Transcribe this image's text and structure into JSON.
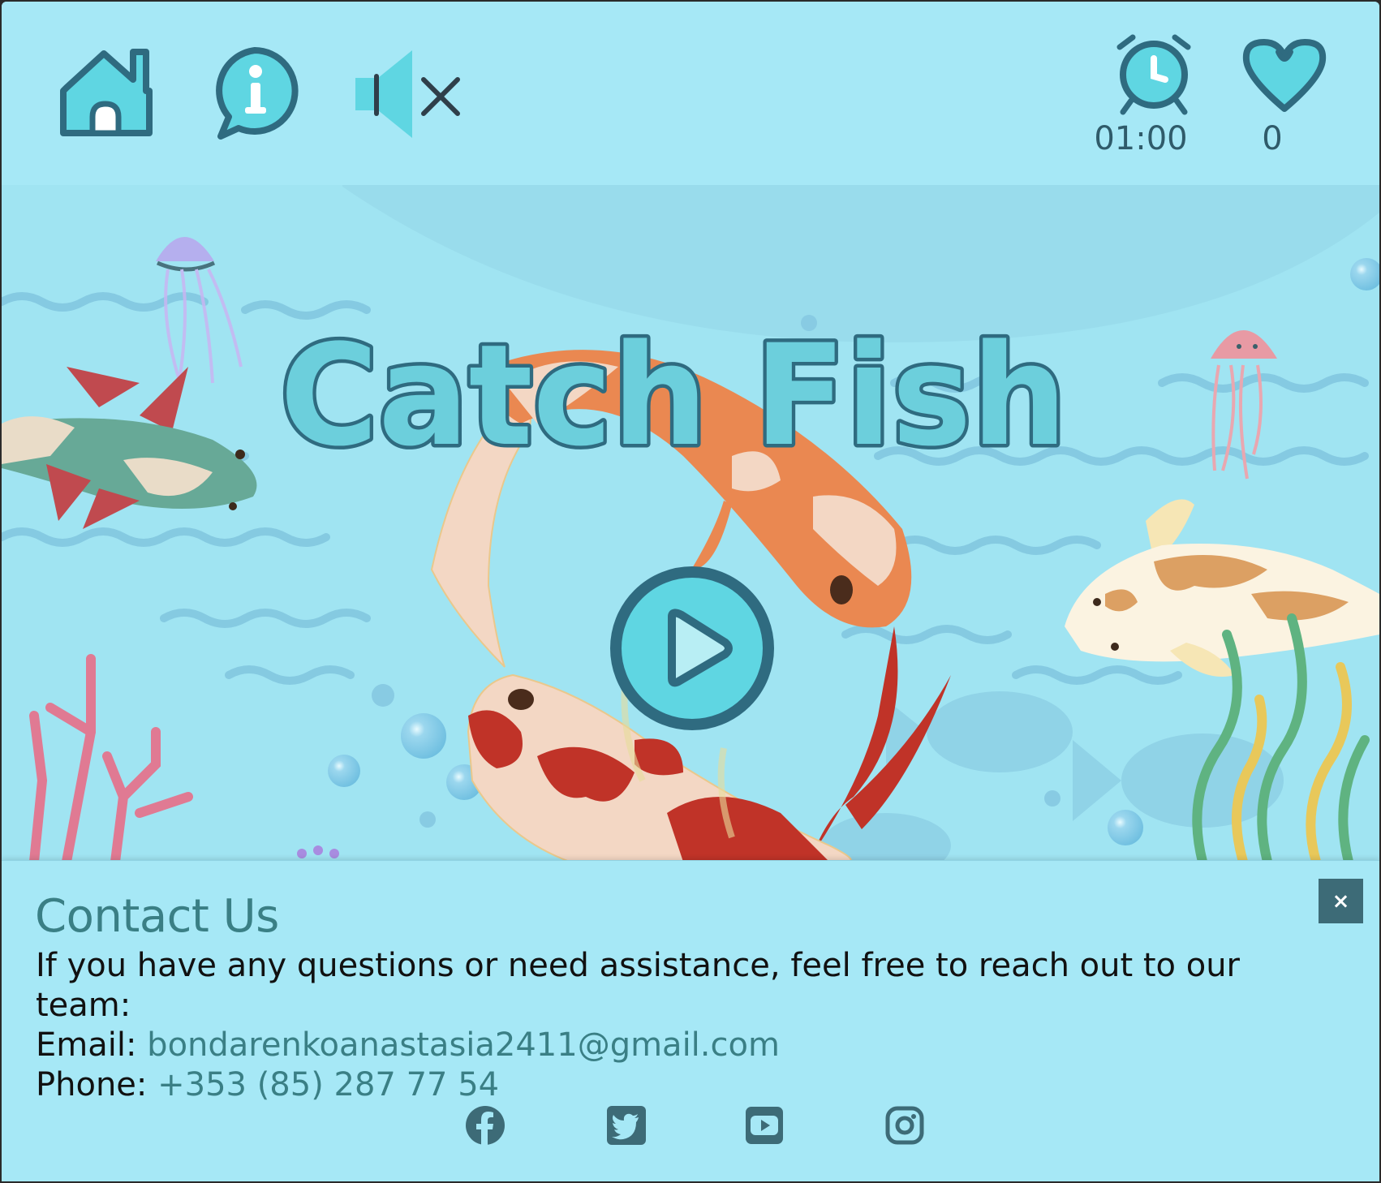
{
  "game": {
    "title": "Catch Fish",
    "timer": "01:00",
    "score": "0"
  },
  "hud": {
    "home_icon": "home-icon",
    "info_icon": "info-icon",
    "sound_icon": "sound-muted-icon",
    "timer_icon": "alarm-clock-icon",
    "score_icon": "heart-icon"
  },
  "play_icon": "play-icon",
  "contact": {
    "title": "Contact Us",
    "description": "If you have any questions or need assistance, feel free to reach out to our team:",
    "email_label": "Email:",
    "email_value": "bondarenkoanastasia2411@gmail.com",
    "phone_label": "Phone:",
    "phone_value": "+353 (85) 287 77 54",
    "close_label": "×",
    "socials": [
      "facebook-icon",
      "twitter-icon",
      "youtube-icon",
      "instagram-icon"
    ]
  },
  "colors": {
    "background": "#a6e8f6",
    "icon_fill": "#5fd6e2",
    "icon_stroke": "#2f6b80",
    "title_fill": "#6ccfdc",
    "accent_text": "#3a7f85",
    "close_button": "#3d6b77"
  }
}
